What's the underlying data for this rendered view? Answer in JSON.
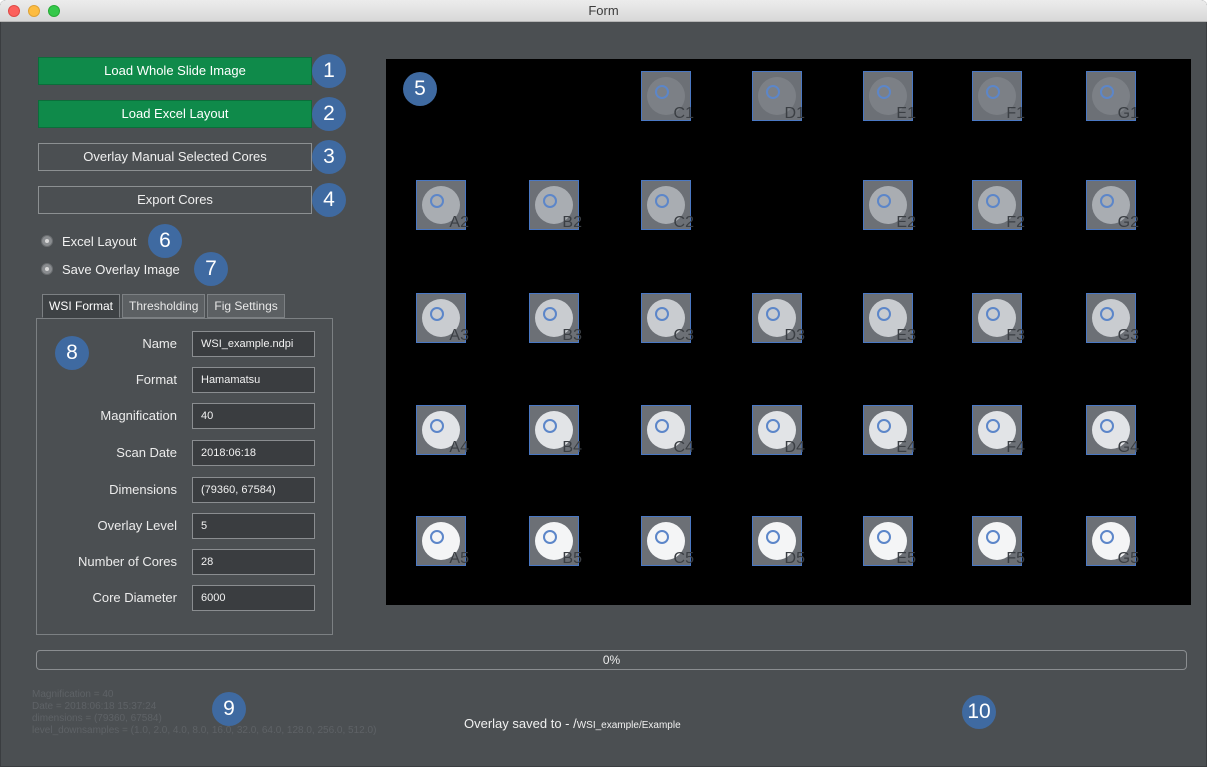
{
  "window": {
    "title": "Form"
  },
  "buttons": [
    {
      "label": "Load Whole Slide Image",
      "style": "green",
      "badge": "1"
    },
    {
      "label": "Load Excel Layout",
      "style": "green",
      "badge": "2"
    },
    {
      "label": "Overlay Manual Selected Cores",
      "style": "plain",
      "badge": "3"
    },
    {
      "label": "Export Cores",
      "style": "plain",
      "badge": "4"
    }
  ],
  "options": [
    {
      "label": "Excel Layout",
      "badge": "6"
    },
    {
      "label": "Save Overlay Image",
      "badge": "7"
    }
  ],
  "canvas": {
    "badge": "5"
  },
  "tabs": [
    {
      "label": "WSI Format",
      "active": true
    },
    {
      "label": "Thresholding",
      "active": false
    },
    {
      "label": "Fig Settings",
      "active": false
    }
  ],
  "panel_badge": "8",
  "wsi_fields": [
    {
      "label": "Name",
      "value": "WSI_example.ndpi"
    },
    {
      "label": "Format",
      "value": "Hamamatsu"
    },
    {
      "label": "Magnification",
      "value": "40"
    },
    {
      "label": "Scan Date",
      "value": "2018:06:18"
    },
    {
      "label": "Dimensions",
      "value": "(79360, 67584)"
    },
    {
      "label": "Overlay Level",
      "value": "5"
    },
    {
      "label": "Number of Cores",
      "value": "28"
    },
    {
      "label": "Core Diameter",
      "value": "6000"
    }
  ],
  "cores": [
    {
      "label": "C1",
      "col": 2,
      "row": 0,
      "shade": "dim"
    },
    {
      "label": "D1",
      "col": 3,
      "row": 0,
      "shade": "dim"
    },
    {
      "label": "E1",
      "col": 4,
      "row": 0,
      "shade": "dim"
    },
    {
      "label": "F1",
      "col": 5,
      "row": 0,
      "shade": "dim"
    },
    {
      "label": "G1",
      "col": 6,
      "row": 0,
      "shade": "dim"
    },
    {
      "label": "A2",
      "col": 0,
      "row": 1,
      "shade": "mid"
    },
    {
      "label": "B2",
      "col": 1,
      "row": 1,
      "shade": "mid"
    },
    {
      "label": "C2",
      "col": 2,
      "row": 1,
      "shade": "mid"
    },
    {
      "label": "E2",
      "col": 4,
      "row": 1,
      "shade": "mid"
    },
    {
      "label": "F2",
      "col": 5,
      "row": 1,
      "shade": "mid"
    },
    {
      "label": "G2",
      "col": 6,
      "row": 1,
      "shade": "mid"
    },
    {
      "label": "A3",
      "col": 0,
      "row": 2,
      "shade": "light"
    },
    {
      "label": "B3",
      "col": 1,
      "row": 2,
      "shade": "light"
    },
    {
      "label": "C3",
      "col": 2,
      "row": 2,
      "shade": "light"
    },
    {
      "label": "D3",
      "col": 3,
      "row": 2,
      "shade": "light"
    },
    {
      "label": "E3",
      "col": 4,
      "row": 2,
      "shade": "light"
    },
    {
      "label": "F3",
      "col": 5,
      "row": 2,
      "shade": "light"
    },
    {
      "label": "G3",
      "col": 6,
      "row": 2,
      "shade": "light"
    },
    {
      "label": "A4",
      "col": 0,
      "row": 3,
      "shade": "bright"
    },
    {
      "label": "B4",
      "col": 1,
      "row": 3,
      "shade": "bright"
    },
    {
      "label": "C4",
      "col": 2,
      "row": 3,
      "shade": "bright"
    },
    {
      "label": "D4",
      "col": 3,
      "row": 3,
      "shade": "bright"
    },
    {
      "label": "E4",
      "col": 4,
      "row": 3,
      "shade": "bright"
    },
    {
      "label": "F4",
      "col": 5,
      "row": 3,
      "shade": "bright"
    },
    {
      "label": "G4",
      "col": 6,
      "row": 3,
      "shade": "bright"
    },
    {
      "label": "A5",
      "col": 0,
      "row": 4,
      "shade": "white"
    },
    {
      "label": "B5",
      "col": 1,
      "row": 4,
      "shade": "white"
    },
    {
      "label": "C5",
      "col": 2,
      "row": 4,
      "shade": "white"
    },
    {
      "label": "D5",
      "col": 3,
      "row": 4,
      "shade": "white"
    },
    {
      "label": "E5",
      "col": 4,
      "row": 4,
      "shade": "white"
    },
    {
      "label": "F5",
      "col": 5,
      "row": 4,
      "shade": "white"
    },
    {
      "label": "G5",
      "col": 6,
      "row": 4,
      "shade": "white"
    }
  ],
  "colors": {
    "dim": "#7c8086",
    "mid": "#a9adb2",
    "light": "#c9ccd0",
    "bright": "#e2e4e7",
    "white": "#f4f5f6"
  },
  "progress": {
    "label": "0%",
    "fraction": 0.0
  },
  "log_lines": [
    "Magnification = 40",
    "Date = 2018:06:18 15:37:24",
    "dimensions = (79360, 67584)",
    "level_downsamples = (1.0, 2.0, 4.0, 8.0, 16.0, 32.0, 64.0, 128.0, 256.0, 512.0)"
  ],
  "log_badge": "9",
  "status": {
    "prefix": "Overlay saved to - /",
    "path": "WSI_example/Example",
    "badge": "10"
  }
}
